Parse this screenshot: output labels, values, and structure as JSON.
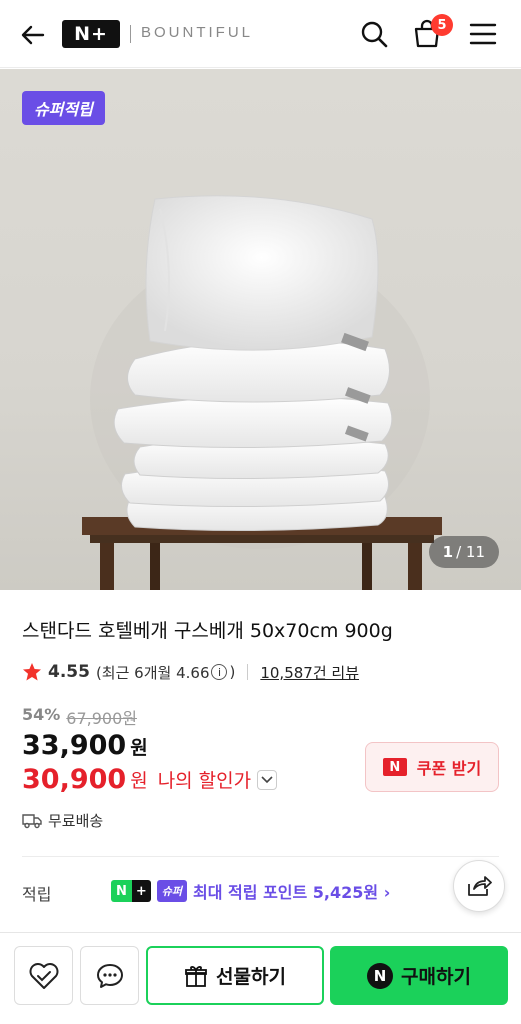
{
  "header": {
    "logo_text": "N+",
    "brand": "BOUNTIFUL",
    "cart_count": "5"
  },
  "product": {
    "super_badge": "슈퍼적립",
    "image_index": "1",
    "image_total": "/ 11",
    "title": "스탠다드 호텔베개 구스베개 50x70cm 900g",
    "rating": "4.55",
    "recent_rating_prefix": "(최근 6개월 4.66",
    "recent_rating_suffix": ")",
    "reviews": "10,587건 리뷰",
    "discount": "54%",
    "original_price": "67,900원",
    "price": "33,900",
    "price_unit": "원",
    "my_price": "30,900",
    "my_price_unit": "원",
    "my_price_label": "나의 할인가",
    "coupon_label": "쿠폰 받기",
    "coupon_n": "N",
    "shipping": "무료배송"
  },
  "points": {
    "label": "적립",
    "badge_n": "N",
    "badge_plus": "+",
    "super": "슈퍼",
    "text": "최대 적립 포인트 5,425원 ›"
  },
  "bottom": {
    "gift_label": "선물하기",
    "buy_n": "N",
    "buy_label": "구매하기"
  },
  "colors": {
    "naver_green": "#1bd15a",
    "super_purple": "#6a4ee6",
    "sale_red": "#e5212b"
  }
}
